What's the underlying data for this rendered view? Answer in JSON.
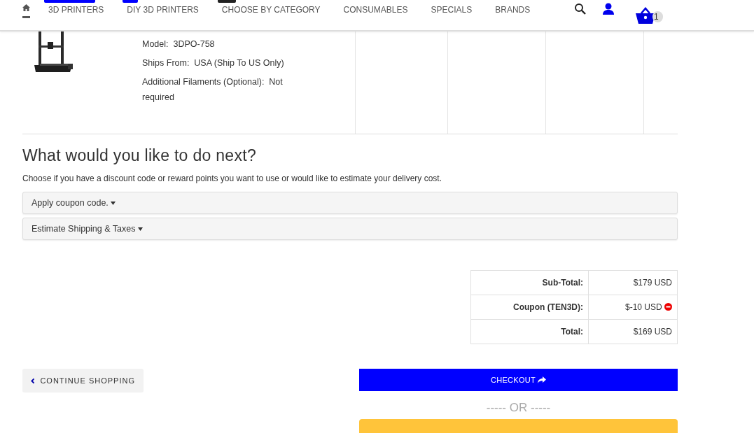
{
  "nav": {
    "home": {
      "selected": true
    },
    "items": [
      {
        "label": "3D PRINTERS",
        "color": "#0000ff"
      },
      {
        "label": "DIY 3D PRINTERS",
        "color": "#0000ff"
      },
      {
        "label": "CHOOSE BY CATEGORY",
        "color": "#222222"
      },
      {
        "label": "CONSUMABLES"
      },
      {
        "label": "SPECIALS"
      },
      {
        "label": "BRANDS"
      }
    ],
    "cart_count": "1"
  },
  "product": {
    "options": [
      {
        "label": "Model:",
        "value": "3DPO-758"
      },
      {
        "label": "Ships From:",
        "value": "USA (Ship To US Only)"
      },
      {
        "label": "Additional Filaments (Optional):",
        "value": "Not required"
      }
    ]
  },
  "next": {
    "heading": "What would you like to do next?",
    "description": "Choose if you have a discount code or reward points you want to use or would like to estimate your delivery cost.",
    "panels": [
      {
        "label": "Apply coupon code.",
        "expanded": false
      },
      {
        "label": "Estimate Shipping & Taxes",
        "expanded": false
      }
    ]
  },
  "totals": [
    {
      "label": "Sub-Total:",
      "value": "$179 USD",
      "removable": false
    },
    {
      "label": "Coupon (TEN3D):",
      "value": "$-10 USD",
      "removable": true
    },
    {
      "label": "Total:",
      "value": "$169 USD",
      "removable": false
    }
  ],
  "buttons": {
    "continue": "CONTINUE SHOPPING",
    "checkout": "CHECKOUT",
    "separator": "----- OR -----"
  }
}
